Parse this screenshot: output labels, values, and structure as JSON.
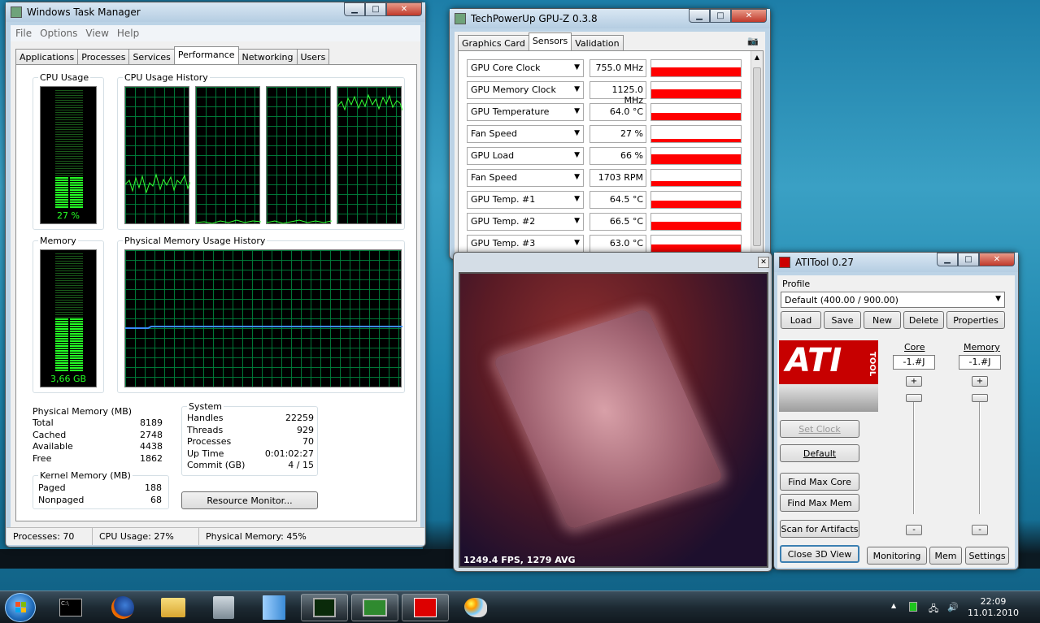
{
  "task_manager": {
    "title": "Windows Task Manager",
    "menu": [
      "File",
      "Options",
      "View",
      "Help"
    ],
    "tabs": [
      "Applications",
      "Processes",
      "Services",
      "Performance",
      "Networking",
      "Users"
    ],
    "active_tab": "Performance",
    "cpu_usage_label": "CPU Usage",
    "cpu_usage_value": "27 %",
    "cpu_usage_fraction": 0.27,
    "cpu_history_label": "CPU Usage History",
    "memory_label": "Memory",
    "memory_value": "3,66 GB",
    "memory_fraction": 0.45,
    "mem_history_label": "Physical Memory Usage History",
    "physical_memory": {
      "title": "Physical Memory (MB)",
      "rows": [
        [
          "Total",
          "8189"
        ],
        [
          "Cached",
          "2748"
        ],
        [
          "Available",
          "4438"
        ],
        [
          "Free",
          "1862"
        ]
      ]
    },
    "kernel_memory": {
      "title": "Kernel Memory (MB)",
      "rows": [
        [
          "Paged",
          "188"
        ],
        [
          "Nonpaged",
          "68"
        ]
      ]
    },
    "system": {
      "title": "System",
      "rows": [
        [
          "Handles",
          "22259"
        ],
        [
          "Threads",
          "929"
        ],
        [
          "Processes",
          "70"
        ],
        [
          "Up Time",
          "0:01:02:27"
        ],
        [
          "Commit (GB)",
          "4 / 15"
        ]
      ]
    },
    "resource_monitor_button": "Resource Monitor...",
    "status": [
      "Processes: 70",
      "CPU Usage: 27%",
      "Physical Memory: 45%"
    ]
  },
  "gpuz": {
    "title": "TechPowerUp GPU-Z 0.3.8",
    "tabs": [
      "Graphics Card",
      "Sensors",
      "Validation"
    ],
    "active_tab": "Sensors",
    "sensors": [
      {
        "name": "GPU Core Clock",
        "value": "755.0 MHz",
        "level": 0.55
      },
      {
        "name": "GPU Memory Clock",
        "value": "1125.0 MHz",
        "level": 0.55
      },
      {
        "name": "GPU Temperature",
        "value": "64.0 °C",
        "level": 0.45
      },
      {
        "name": "Fan Speed",
        "value": "27 %",
        "level": 0.2
      },
      {
        "name": "GPU Load",
        "value": "66 %",
        "level": 0.6
      },
      {
        "name": "Fan Speed",
        "value": "1703 RPM",
        "level": 0.3
      },
      {
        "name": "GPU Temp. #1",
        "value": "64.5 °C",
        "level": 0.45
      },
      {
        "name": "GPU Temp. #2",
        "value": "66.5 °C",
        "level": 0.5
      },
      {
        "name": "GPU Temp. #3",
        "value": "63.0 °C",
        "level": 0.45
      }
    ]
  },
  "view3d": {
    "fps": "1249.4 FPS, 1279 AVG"
  },
  "atitool": {
    "title": "ATITool 0.27",
    "profile_label": "Profile",
    "profile_value": "Default (400.00 / 900.00)",
    "profile_buttons": [
      "Load",
      "Save",
      "New",
      "Delete",
      "Properties"
    ],
    "core_label": "Core",
    "memory_label": "Memory",
    "core_value": "-1.#J",
    "memory_value": "-1.#J",
    "logo_text": "ATI",
    "logo_sub": "TOOL",
    "buttons": {
      "set_clock": "Set Clock",
      "default": "Default",
      "find_max_core": "Find Max Core",
      "find_max_mem": "Find Max Mem",
      "scan_artifacts": "Scan for Artifacts",
      "close_3d": "Close 3D View",
      "monitoring": "Monitoring",
      "mem": "Mem",
      "settings": "Settings"
    }
  },
  "taskbar": {
    "time": "22:09",
    "date": "11.01.2010"
  }
}
